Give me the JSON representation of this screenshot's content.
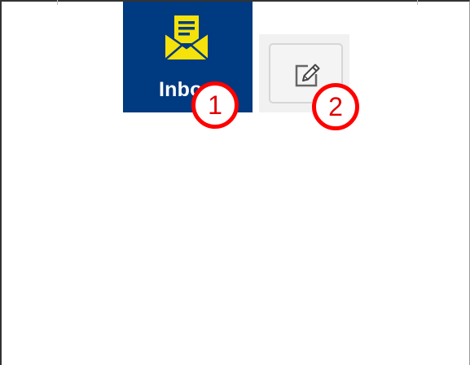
{
  "inbox": {
    "label": "Inbox",
    "icon": "envelope-letter-icon",
    "background_color": "#003a80",
    "icon_color": "#f5e20a"
  },
  "compose": {
    "icon": "edit-pencil-icon"
  },
  "annotations": {
    "callout_1": "1",
    "callout_2": "2",
    "color": "#ff0000"
  }
}
